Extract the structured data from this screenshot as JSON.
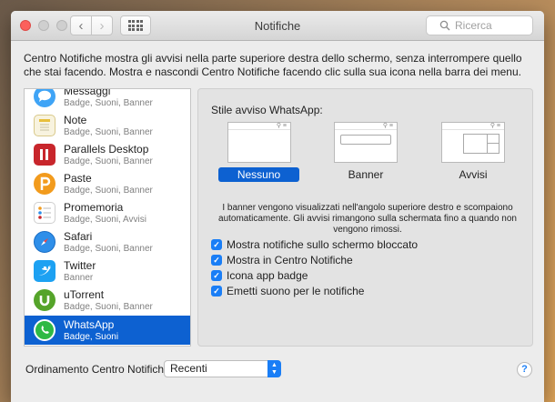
{
  "window": {
    "title": "Notifiche"
  },
  "search": {
    "placeholder": "Ricerca"
  },
  "intro_text": "Centro Notifiche mostra gli avvisi nella parte superiore destra dello schermo, senza interrompere quello che stai facendo. Mostra e nascondi Centro Notifiche facendo clic sulla sua icona nella barra dei menu.",
  "apps": [
    {
      "name": "Messaggi",
      "sub": "Badge, Suoni, Banner",
      "icon": "messages-icon",
      "color": "#3fa4f6"
    },
    {
      "name": "Note",
      "sub": "Badge, Suoni, Banner",
      "icon": "notes-icon",
      "color": "#f2d35a"
    },
    {
      "name": "Parallels Desktop",
      "sub": "Badge, Suoni, Banner",
      "icon": "parallels-icon",
      "color": "#c8262c"
    },
    {
      "name": "Paste",
      "sub": "Badge, Suoni, Banner",
      "icon": "paste-icon",
      "color": "#f29b1d"
    },
    {
      "name": "Promemoria",
      "sub": "Badge, Suoni, Avvisi",
      "icon": "reminders-icon",
      "color": "#ffffff"
    },
    {
      "name": "Safari",
      "sub": "Badge, Suoni, Banner",
      "icon": "safari-icon",
      "color": "#2f8fe9"
    },
    {
      "name": "Twitter",
      "sub": "Banner",
      "icon": "twitter-icon",
      "color": "#1da1f2"
    },
    {
      "name": "uTorrent",
      "sub": "Badge, Suoni, Banner",
      "icon": "utorrent-icon",
      "color": "#55a42a"
    },
    {
      "name": "WhatsApp",
      "sub": "Badge, Suoni",
      "icon": "whatsapp-icon",
      "color": "#2fb945"
    }
  ],
  "selected_app": "WhatsApp",
  "panel": {
    "style_label": "Stile avviso WhatsApp:",
    "styles": [
      "Nessuno",
      "Banner",
      "Avvisi"
    ],
    "selected_style": "Nessuno",
    "description": "I banner vengono visualizzati nell'angolo superiore destro e scompaiono automaticamente. Gli avvisi rimangono sulla schermata fino a quando non vengono rimossi.",
    "checkboxes": [
      {
        "label": "Mostra notifiche sullo schermo bloccato",
        "checked": true
      },
      {
        "label": "Mostra in Centro Notifiche",
        "checked": true
      },
      {
        "label": "Icona app badge",
        "checked": true
      },
      {
        "label": "Emetti suono per le notifiche",
        "checked": true
      }
    ]
  },
  "footer": {
    "sort_label": "Ordinamento Centro Notifiche:",
    "sort_value": "Recenti",
    "help_label": "?"
  },
  "colors": {
    "accent": "#0d61d1",
    "checkbox": "#1a7ef6"
  }
}
